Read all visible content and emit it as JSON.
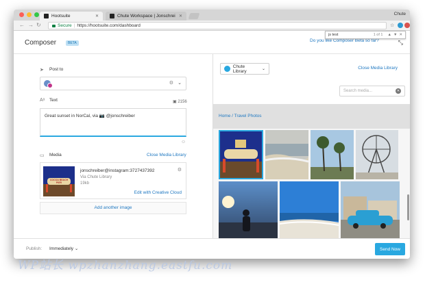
{
  "browser": {
    "tabs": [
      {
        "label": "Hootsuite"
      },
      {
        "label": "Chute Workspace | Jonschrei"
      }
    ],
    "user": "Chute",
    "secure_label": "Secure",
    "url": "https://hootsuite.com/dashboard",
    "find": {
      "query": "js test",
      "count": "1 of 1"
    }
  },
  "composer": {
    "title": "Composer",
    "beta": "BETA",
    "feedback_link": "Do you like Composer Beta so far?"
  },
  "left": {
    "post_to_label": "Post to",
    "text_label": "Text",
    "char_count": "2156",
    "message": "Great sunset in NorCal, via 📷 @jonschreiber",
    "media_label": "Media",
    "close_media_link": "Close Media Library",
    "media_item": {
      "handle": "jonschreiber@instagram:3727437392",
      "source": "Via Chute Library",
      "size": "19kb",
      "edit_link": "Edit with Creative Cloud",
      "thumb_sign": "COCOA BEACH PIER"
    },
    "add_image": "Add another image"
  },
  "right": {
    "library_select": "Chute Library",
    "close_library": "Close Media Library",
    "search_placeholder": "Search media...",
    "breadcrumb": "Home / Travel Photos"
  },
  "footer": {
    "publish_label": "Publish:",
    "publish_value": "Immediately",
    "send_button": "Send Now"
  },
  "watermark": "WP站长 wpzhanzhang.eastfu.com",
  "colors": {
    "accent": "#29a8e0",
    "link": "#1f78c1"
  }
}
